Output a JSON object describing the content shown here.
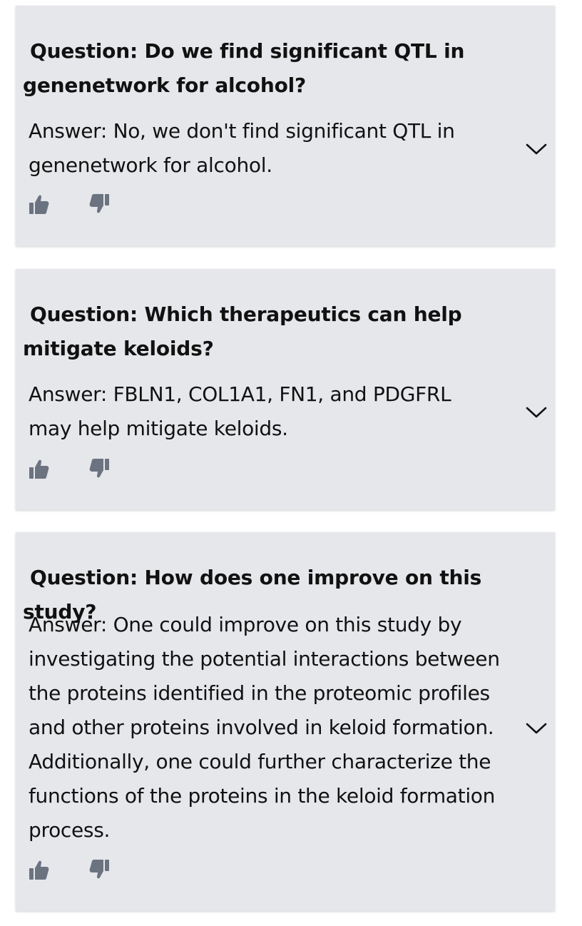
{
  "cards": [
    {
      "question": "Question: Do we find significant QTL in genenetwork for alcohol?",
      "answer": "Answer: No, we don't find significant QTL in genenetwork for alcohol."
    },
    {
      "question": "Question: Which therapeutics can help mitigate keloids?",
      "answer": "Answer: FBLN1, COL1A1, FN1, and PDGFRL may help mitigate keloids."
    },
    {
      "question": "Question: How does one improve on this study?",
      "answer": "Answer: One could improve on this study by investigating the potential interactions between the proteins identified in the proteomic profiles and other proteins involved in keloid formation. Additionally, one could further characterize the functions of the proteins in the keloid formation process."
    }
  ],
  "icons": {
    "expand": "chevron-down-icon",
    "like": "thumbs-up-icon",
    "dislike": "thumbs-down-icon"
  },
  "colors": {
    "card_background": "#e6e7eb",
    "icon": "#6b7280",
    "text": "#111111"
  }
}
